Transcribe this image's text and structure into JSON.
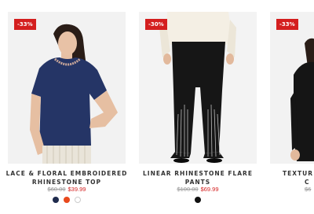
{
  "products": [
    {
      "badge": "-33%",
      "title": "LACE & FLORAL EMBROIDERED RHINESTONE TOP",
      "price_old": "$60.00",
      "price_new": "$39.99",
      "swatches": [
        "#1f2b4d",
        "#e8491d",
        "#ffffff"
      ],
      "image": "model-navy-lace-top"
    },
    {
      "badge": "-30%",
      "title": "LINEAR RHINESTONE FLARE PANTS",
      "price_old": "$100.00",
      "price_new": "$69.99",
      "swatches": [
        "#111111"
      ],
      "image": "model-black-flare-pants"
    },
    {
      "badge": "-33%",
      "title": "TEXTUR",
      "title_line2": "C",
      "price_old": "$6",
      "image": "model-black-top"
    }
  ]
}
